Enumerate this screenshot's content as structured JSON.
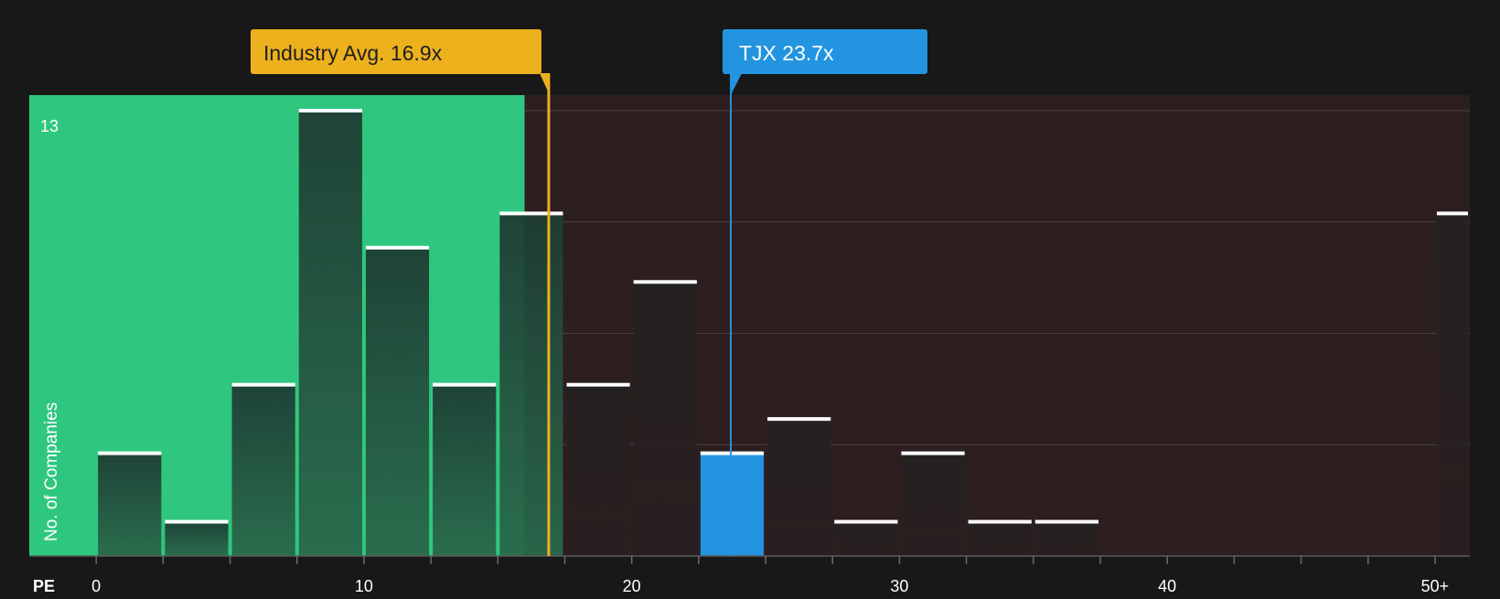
{
  "colors": {
    "background": "#181818",
    "fair_zone": "#2fc77f",
    "expensive_zone": "#2d1e1f",
    "bar_cheap": "#21433a",
    "bar_expensive": "#232020",
    "bar_highlight": "#2394df",
    "bar_top": "#ffffff",
    "industry_marker": "#ecb11d",
    "company_marker": "#2394df",
    "axis_text": "#ffffff",
    "grid": "#4a4040"
  },
  "callouts": {
    "industry": "Industry Avg. 16.9x",
    "company": "TJX 23.7x"
  },
  "chart_data": {
    "type": "bar",
    "xlabel": "PE",
    "ylabel": "No. of Companies",
    "y_max_label": "13",
    "ylim": [
      0,
      13
    ],
    "xlim": [
      -2.5,
      51.3
    ],
    "grid": true,
    "x_ticks": [
      {
        "value": 0,
        "label": "0"
      },
      {
        "value": 10,
        "label": "10"
      },
      {
        "value": 20,
        "label": "20"
      },
      {
        "value": 30,
        "label": "30"
      },
      {
        "value": 40,
        "label": "40"
      },
      {
        "value": 50,
        "label": "50+"
      }
    ],
    "bins": [
      {
        "x0": 0,
        "x1": 2.5,
        "count": 3
      },
      {
        "x0": 2.5,
        "x1": 5,
        "count": 1
      },
      {
        "x0": 5,
        "x1": 7.5,
        "count": 5
      },
      {
        "x0": 7.5,
        "x1": 10,
        "count": 13
      },
      {
        "x0": 10,
        "x1": 12.5,
        "count": 9
      },
      {
        "x0": 12.5,
        "x1": 15,
        "count": 5
      },
      {
        "x0": 15,
        "x1": 17.5,
        "count": 10
      },
      {
        "x0": 17.5,
        "x1": 20,
        "count": 5
      },
      {
        "x0": 20,
        "x1": 22.5,
        "count": 8
      },
      {
        "x0": 22.5,
        "x1": 25,
        "count": 3,
        "highlight": true
      },
      {
        "x0": 25,
        "x1": 27.5,
        "count": 4
      },
      {
        "x0": 27.5,
        "x1": 30,
        "count": 1
      },
      {
        "x0": 30,
        "x1": 32.5,
        "count": 3
      },
      {
        "x0": 32.5,
        "x1": 35,
        "count": 1
      },
      {
        "x0": 35,
        "x1": 37.5,
        "count": 1
      },
      {
        "x0": 37.5,
        "x1": 40,
        "count": 0
      },
      {
        "x0": 40,
        "x1": 42.5,
        "count": 0
      },
      {
        "x0": 42.5,
        "x1": 45,
        "count": 0
      },
      {
        "x0": 45,
        "x1": 47.5,
        "count": 0
      },
      {
        "x0": 47.5,
        "x1": 50,
        "count": 0
      },
      {
        "x0": 50,
        "x1": 51.3,
        "count": 10
      }
    ],
    "fair_zone_end": 16.0,
    "industry_avg": 16.9,
    "company_value": 23.7
  }
}
